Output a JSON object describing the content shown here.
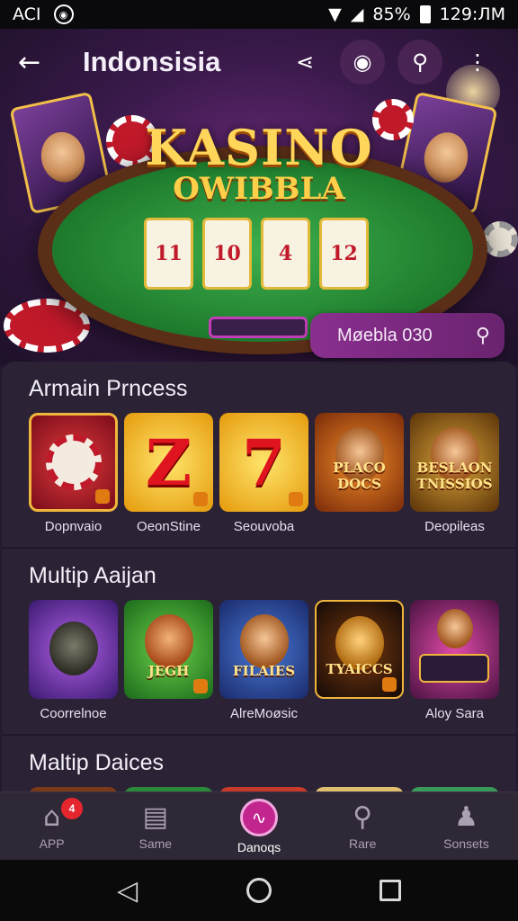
{
  "status_bar": {
    "carrier": "ACI",
    "battery": "85%",
    "time": "129:ЛМ"
  },
  "app_bar": {
    "title": "Indonsisia",
    "back_icon": "arrow-left-icon",
    "actions": [
      "share-icon",
      "chat-search-icon",
      "search-icon",
      "more-vert-icon"
    ]
  },
  "hero": {
    "logo_line1": "KASINO",
    "logo_line2": "OWIBBLA",
    "reels": [
      "11",
      "10",
      "4",
      "12"
    ],
    "search_pill": "Møebla 030"
  },
  "sections": [
    {
      "title": "Armain Prncess",
      "tiles": [
        {
          "kind": "chips",
          "label": "Dopnvaio"
        },
        {
          "kind": "seven",
          "big": "Z",
          "label": "OeonStine"
        },
        {
          "kind": "seven",
          "big": "7",
          "label": "Seouvoba"
        },
        {
          "kind": "face",
          "word": "PLACO DOCS",
          "label": ""
        },
        {
          "kind": "face",
          "word": "BESLAON TNISSIOS",
          "label": "Deopileas"
        }
      ]
    },
    {
      "title": "Multip Aaijan",
      "tiles": [
        {
          "kind": "monster",
          "label": "Coorrelnoe"
        },
        {
          "kind": "monkey",
          "word": "JEGH",
          "label": ""
        },
        {
          "kind": "cowboy",
          "word": "FILAIES",
          "label": "AlreMoøsic"
        },
        {
          "kind": "gold",
          "word": "TYAICCS",
          "label": ""
        },
        {
          "kind": "slots",
          "label": "Aloy Sara"
        }
      ]
    },
    {
      "title": "Maltip Daices"
    }
  ],
  "bottom_nav": [
    {
      "label": "APP",
      "icon": "home-icon",
      "badge": "4"
    },
    {
      "label": "Same",
      "icon": "store-icon"
    },
    {
      "label": "Danoqs",
      "icon": "heartbeat-icon",
      "active": true
    },
    {
      "label": "Rare",
      "icon": "search-icon"
    },
    {
      "label": "Sonsets",
      "icon": "profile-icon"
    }
  ],
  "colors": {
    "accent": "#c3258e",
    "background": "#241a30",
    "gold": "#ffd65a"
  }
}
